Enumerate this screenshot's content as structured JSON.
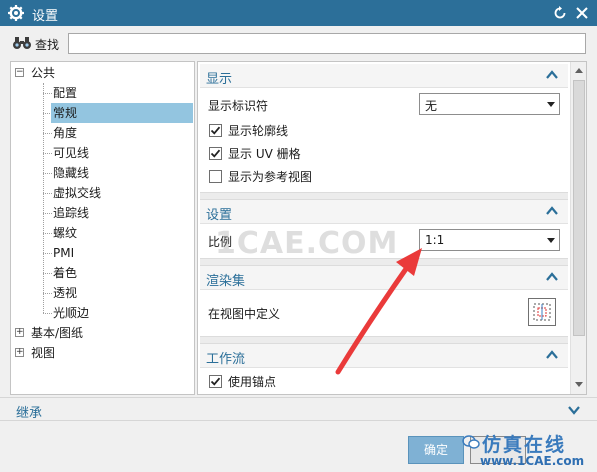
{
  "window": {
    "title": "设置"
  },
  "find": {
    "label": "查找",
    "value": ""
  },
  "tree": {
    "root": "公共",
    "children": [
      "配置",
      "常规",
      "角度",
      "可见线",
      "隐藏线",
      "虚拟交线",
      "追踪线",
      "螺纹",
      "PMI",
      "着色",
      "透视",
      "光顺边"
    ],
    "selected": "常规",
    "others": [
      "基本/图纸",
      "视图"
    ]
  },
  "sections": {
    "display": {
      "title": "显示",
      "identifier_label": "显示标识符",
      "identifier_value": "无",
      "checkboxes": [
        {
          "label": "显示轮廓线",
          "checked": true
        },
        {
          "label": "显示 UV 栅格",
          "checked": true
        },
        {
          "label": "显示为参考视图",
          "checked": false
        }
      ]
    },
    "settings": {
      "title": "设置",
      "scale_label": "比例",
      "scale_value": "1:1"
    },
    "render_set": {
      "title": "渲染集",
      "defined_in_view_label": "在视图中定义"
    },
    "workflow": {
      "title": "工作流",
      "checkbox": {
        "label": "使用锚点",
        "checked": true
      }
    }
  },
  "inherit": {
    "title": "继承"
  },
  "buttons": {
    "ok": "确定"
  },
  "watermark": {
    "main": "1CAE.COM",
    "cn": "仿真在线",
    "url": "www.1CAE.com"
  },
  "colors": {
    "titlebar": "#2c6f99",
    "section_title": "#2b6f99",
    "selection": "#93c5e0",
    "arrow": "#ea3a3a"
  },
  "icons": [
    "gear-icon",
    "reset-icon",
    "close-icon",
    "binoculars-icon",
    "chevron-up-icon",
    "chevron-down-icon",
    "view-define-icon",
    "expand-icon",
    "collapse-icon"
  ]
}
